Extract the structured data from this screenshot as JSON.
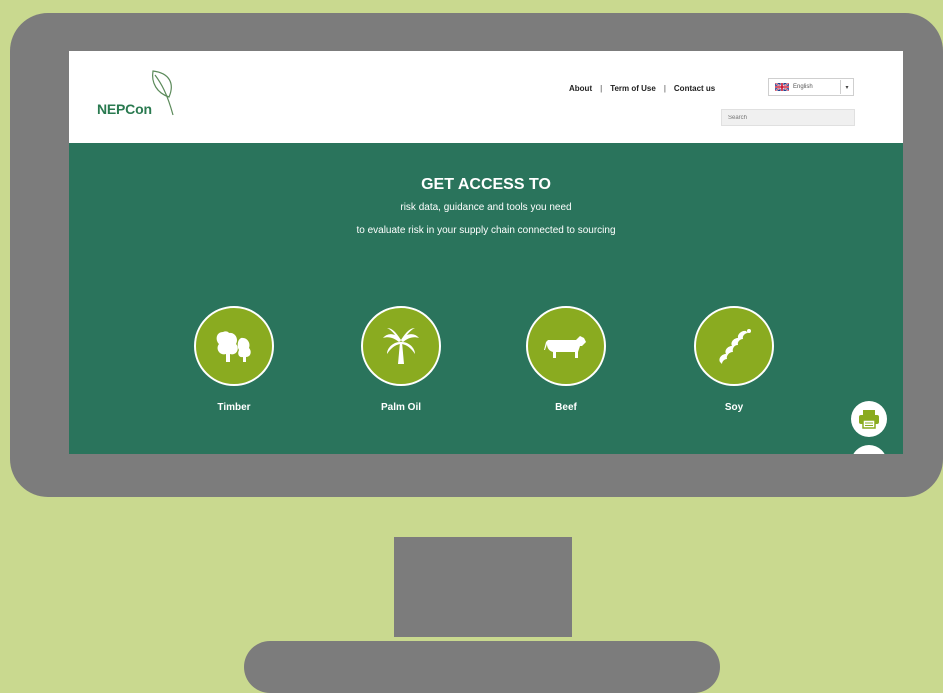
{
  "header": {
    "logo_text": "NEPCon",
    "nav": {
      "about": "About",
      "terms": "Term of Use",
      "contact": "Contact us",
      "separator": "|"
    },
    "language": {
      "selected": "English"
    },
    "search": {
      "placeholder": "Search"
    }
  },
  "hero": {
    "title": "GET ACCESS TO",
    "subtitle_line1": "risk data, guidance and tools you need",
    "subtitle_line2": "to evaluate risk in your supply chain connected to sourcing"
  },
  "categories": [
    {
      "label": "Timber",
      "icon": "trees-icon"
    },
    {
      "label": "Palm Oil",
      "icon": "palm-tree-icon"
    },
    {
      "label": "Beef",
      "icon": "cow-icon"
    },
    {
      "label": "Soy",
      "icon": "soy-pod-icon"
    }
  ],
  "floating": {
    "print_icon": "print-icon"
  },
  "colors": {
    "background": "#c9d98f",
    "monitor": "#7c7c7c",
    "hero": "#2a745c",
    "category_circle": "#8aab20",
    "logo_green": "#2a7a50"
  }
}
